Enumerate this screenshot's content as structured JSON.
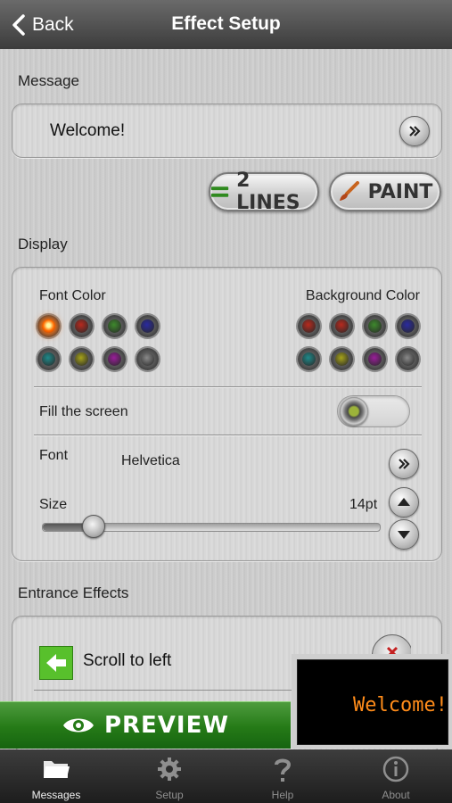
{
  "navbar": {
    "back_label": "Back",
    "title": "Effect Setup"
  },
  "message_section": {
    "label": "Message",
    "text": "Welcome!"
  },
  "buttons": {
    "lines_label": "2 LINES",
    "paint_label": "PAINT"
  },
  "display_section": {
    "label": "Display",
    "font_color_label": "Font Color",
    "background_color_label": "Background Color",
    "font_colors": [
      {
        "color": "#ff6a00",
        "selected": true
      },
      {
        "color": "#b82a1e",
        "selected": false
      },
      {
        "color": "#3e8a2c",
        "selected": false
      },
      {
        "color": "#2a2aa0",
        "selected": false
      },
      {
        "color": "#1f8a8a",
        "selected": false
      },
      {
        "color": "#a6a31a",
        "selected": false
      },
      {
        "color": "#9a1e9a",
        "selected": false
      },
      {
        "color": "#8a8a8a",
        "selected": false
      }
    ],
    "background_colors": [
      {
        "color": "#b82a1e",
        "selected": false
      },
      {
        "color": "#b82a1e",
        "selected": false
      },
      {
        "color": "#3e8a2c",
        "selected": false
      },
      {
        "color": "#2a2aa0",
        "selected": false
      },
      {
        "color": "#1f8a8a",
        "selected": false
      },
      {
        "color": "#a6a31a",
        "selected": false
      },
      {
        "color": "#9a1e9a",
        "selected": false
      },
      {
        "color": "#8a8a8a",
        "selected": false
      }
    ],
    "fill_screen_label": "Fill the screen",
    "fill_screen_on": false,
    "font_label": "Font",
    "font_value": "Helvetica",
    "size_label": "Size",
    "size_value": "14pt",
    "size_level_fraction": 0.15
  },
  "entrance_section": {
    "label": "Entrance Effects",
    "effect_label": "Scroll to left"
  },
  "preview": {
    "button_label": "PREVIEW",
    "screen_text": "Welcome!",
    "screen_text_color": "#ff8c1a"
  },
  "tabbar": {
    "tabs": [
      {
        "label": "Messages",
        "icon": "folder-icon",
        "active": true
      },
      {
        "label": "Setup",
        "icon": "gear-icon",
        "active": false
      },
      {
        "label": "Help",
        "icon": "question-icon",
        "active": false
      },
      {
        "label": "About",
        "icon": "info-icon",
        "active": false
      }
    ]
  }
}
